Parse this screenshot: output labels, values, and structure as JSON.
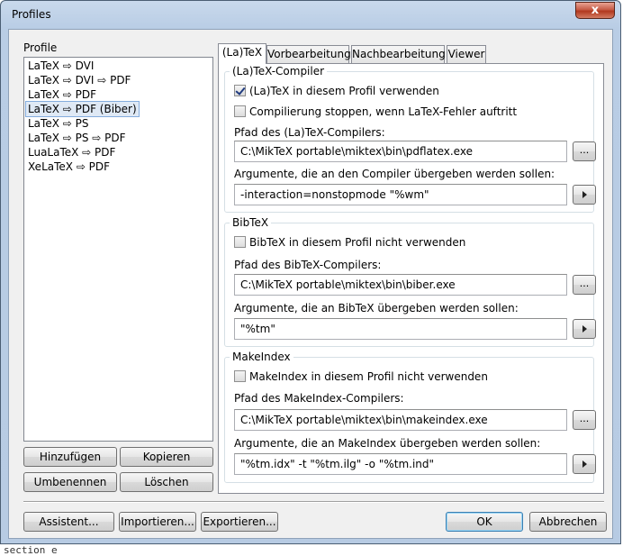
{
  "window": {
    "title": "Profiles",
    "close_label": "x"
  },
  "profile_label": "Profile",
  "profiles": [
    "LaTeX ⇨ DVI",
    "LaTeX ⇨ DVI ⇨ PDF",
    "LaTeX ⇨ PDF",
    "LaTeX ⇨ PDF (Biber)",
    "LaTeX ⇨ PS",
    "LaTeX ⇨ PS ⇨ PDF",
    "LuaLaTeX ⇨ PDF",
    "XeLaTeX ⇨ PDF"
  ],
  "selected_profile": "LaTeX ⇨ PDF (Biber)",
  "list_buttons": {
    "add": "Hinzufügen",
    "copy": "Kopieren",
    "rename": "Umbenennen",
    "delete": "Löschen"
  },
  "tabs": [
    "(La)TeX",
    "Vorbearbeitung",
    "Nachbearbeitung",
    "Viewer"
  ],
  "latex": {
    "title": "(La)TeX-Compiler",
    "use_check": "(La)TeX in diesem Profil verwenden",
    "stop_check": "Compilierung stoppen, wenn LaTeX-Fehler auftritt",
    "path_label": "Pfad des (La)TeX-Compilers:",
    "path_value": "C:\\MikTeX portable\\miktex\\bin\\pdflatex.exe",
    "args_label": "Argumente, die an den Compiler übergeben werden sollen:",
    "args_value": "-interaction=nonstopmode \"%wm\""
  },
  "bibtex": {
    "title": "BibTeX",
    "disable_check": "BibTeX in diesem Profil nicht verwenden",
    "path_label": "Pfad des BibTeX-Compilers:",
    "path_value": "C:\\MikTeX portable\\miktex\\bin\\biber.exe",
    "args_label": "Argumente, die an BibTeX übergeben werden sollen:",
    "args_value": "\"%tm\""
  },
  "makeindex": {
    "title": "MakeIndex",
    "disable_check": "MakeIndex in diesem Profil nicht verwenden",
    "path_label": "Pfad des MakeIndex-Compilers:",
    "path_value": "C:\\MikTeX portable\\miktex\\bin\\makeindex.exe",
    "args_label": "Argumente, die an MakeIndex übergeben werden sollen:",
    "args_value": "\"%tm.idx\" -t \"%tm.ilg\" -o \"%tm.ind\""
  },
  "browse_label": "...",
  "footer": {
    "wizard": "Assistent...",
    "import": "Importieren...",
    "export": "Exportieren...",
    "ok": "OK",
    "cancel": "Abbrechen"
  },
  "background_text": "section e"
}
